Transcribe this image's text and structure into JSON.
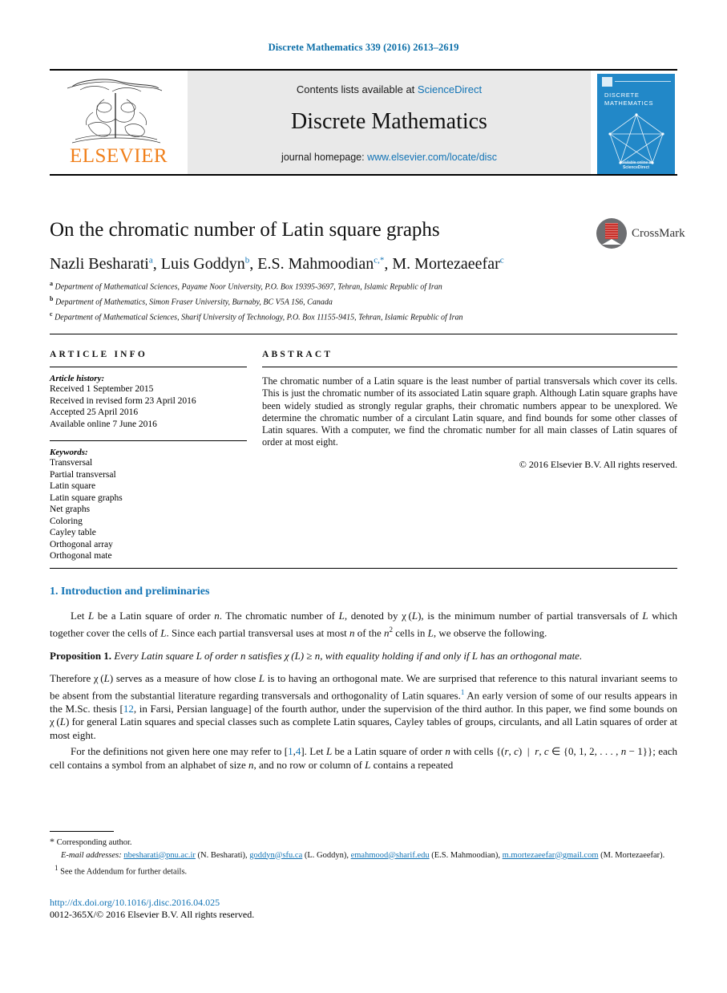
{
  "running_head": "Discrete Mathematics 339 (2016) 2613–2619",
  "masthead": {
    "elsevier_wordmark": "ELSEVIER",
    "contents_prefix": "Contents lists available at ",
    "sciencedirect": "ScienceDirect",
    "journal_title": "Discrete Mathematics",
    "homepage_prefix": "journal homepage: ",
    "homepage_url": "www.elsevier.com/locate/disc",
    "cover_name_line1": "DISCRETE",
    "cover_name_line2": "MATHEMATICS",
    "cover_footer": "Available online at\nScienceDirect"
  },
  "article": {
    "title": "On the chromatic number of Latin square graphs",
    "crossmark_label": "CrossMark",
    "authors_html": "Nazli Besharati<sup class=\"aff-mark\">a</sup>, Luis Goddyn<sup class=\"aff-mark\">b</sup>, E.S. Mahmoodian<sup class=\"aff-mark\">c,<span class=\"star\">*</span></sup>, M. Mortezaeefar<sup class=\"aff-mark\">c</sup>",
    "affiliations": [
      {
        "mark": "a",
        "text": "Department of Mathematical Sciences, Payame Noor University, P.O. Box 19395-3697, Tehran, Islamic Republic of Iran"
      },
      {
        "mark": "b",
        "text": "Department of Mathematics, Simon Fraser University, Burnaby, BC V5A 1S6, Canada"
      },
      {
        "mark": "c",
        "text": "Department of Mathematical Sciences, Sharif University of Technology, P.O. Box 11155-9415, Tehran, Islamic Republic of Iran"
      }
    ]
  },
  "info": {
    "heading": "ARTICLE INFO",
    "history_label": "Article history:",
    "history": [
      "Received 1 September 2015",
      "Received in revised form 23 April 2016",
      "Accepted 25 April 2016",
      "Available online 7 June 2016"
    ],
    "keywords_label": "Keywords:",
    "keywords": [
      "Transversal",
      "Partial transversal",
      "Latin square",
      "Latin square graphs",
      "Net graphs",
      "Coloring",
      "Cayley table",
      "Orthogonal array",
      "Orthogonal mate"
    ]
  },
  "abstract": {
    "heading": "ABSTRACT",
    "text": "The chromatic number of a Latin square is the least number of partial transversals which cover its cells. This is just the chromatic number of its associated Latin square graph. Although Latin square graphs have been widely studied as strongly regular graphs, their chromatic numbers appear to be unexplored. We determine the chromatic number of a circulant Latin square, and find bounds for some other classes of Latin squares. With a computer, we find the chromatic number for all main classes of Latin squares of order at most eight.",
    "copyright": "© 2016 Elsevier B.V. All rights reserved."
  },
  "body": {
    "section_title": "1. Introduction and preliminaries",
    "para1_html": "Let <i>L</i> be a Latin square of order <i>n</i>. The chromatic number of <i>L</i>, denoted by &chi;&thinsp;(<i>L</i>), is the minimum number of partial transversals of <i>L</i> which together cover the cells of <i>L</i>. Since each partial transversal uses at most <i>n</i> of the <i>n</i><sup class=\"supk\">2</sup> cells in <i>L</i>, we observe the following.",
    "proposition_label": "Proposition 1.",
    "proposition_html": "Every Latin square <i>L</i> of order <i>n</i> satisfies &chi;&thinsp;(<i>L</i>) &ge; <i>n</i>, with equality holding if and only if <i>L</i> has an orthogonal mate.",
    "para2_html": "Therefore &chi;&thinsp;(<i>L</i>) serves as a measure of how close <i>L</i> is to having an orthogonal mate. We are surprised that reference to this natural invariant seems to be absent from the substantial literature regarding transversals and orthogonality of Latin squares.<sup class=\"sup\">1</sup> An early version of some of our results appears in the M.Sc. thesis [<span class=\"ref\">12</span>, in Farsi, Persian language] of the fourth author, under the supervision of the third author. In this paper, we find some bounds on &chi;&thinsp;(<i>L</i>) for general Latin squares and special classes such as complete Latin squares, Cayley tables of groups, circulants, and all Latin squares of order at most eight.",
    "para3_html": "For the definitions not given here one may refer to [<span class=\"ref\">1</span>,<span class=\"ref\">4</span>]. Let <i>L</i> be a Latin square of order <i>n</i> with cells {(<i>r</i>, <i>c</i>) &nbsp;|&nbsp; <i>r</i>, <i>c</i> &isin; {0, 1, 2, . . . , <i>n</i> &minus; 1}}; each cell contains a symbol from an alphabet of size <i>n</i>, and no row or column of <i>L</i> contains a repeated"
  },
  "footnotes": {
    "corresponding": "Corresponding author.",
    "email_label": "E-mail addresses:",
    "emails": [
      {
        "addr": "nbesharati@pnu.ac.ir",
        "who": "(N. Besharati)"
      },
      {
        "addr": "goddyn@sfu.ca",
        "who": "(L. Goddyn)"
      },
      {
        "addr": "emahmood@sharif.edu",
        "who": "(E.S. Mahmoodian)"
      },
      {
        "addr": "m.mortezaeefar@gmail.com",
        "who": "(M. Mortezaeefar)"
      }
    ],
    "note1_mark": "1",
    "note1": "See the Addendum for further details."
  },
  "footer": {
    "doi": "http://dx.doi.org/10.1016/j.disc.2016.04.025",
    "issn_line": "0012-365X/© 2016 Elsevier B.V. All rights reserved."
  },
  "colors": {
    "link": "#1173b5",
    "running_head": "#0b6ea8",
    "elsevier_orange": "#f07f1a",
    "cover_blue": "#2288c8",
    "crossmark_red": "#c9312b"
  }
}
